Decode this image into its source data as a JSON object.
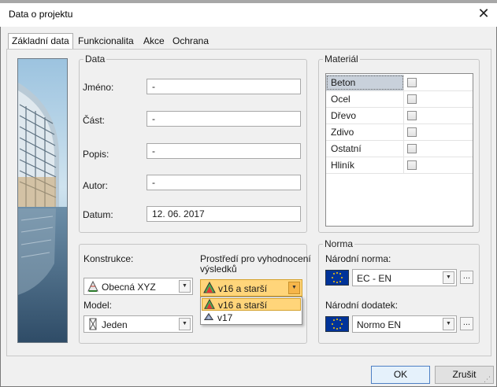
{
  "window": {
    "title": "Data o projektu",
    "close_glyph": "✕"
  },
  "tabs": [
    {
      "label": "Základní data",
      "active": true
    },
    {
      "label": "Funkcionalita",
      "active": false
    },
    {
      "label": "Akce",
      "active": false
    },
    {
      "label": "Ochrana",
      "active": false
    }
  ],
  "data_group": {
    "legend": "Data",
    "fields": [
      {
        "label": "Jméno:",
        "value": "-"
      },
      {
        "label": "Část:",
        "value": "-"
      },
      {
        "label": "Popis:",
        "value": "-"
      },
      {
        "label": "Autor:",
        "value": "-"
      },
      {
        "label": "Datum:",
        "value": "12. 06. 2017"
      }
    ]
  },
  "material_group": {
    "legend": "Materiál",
    "items": [
      {
        "name": "Beton",
        "checked": false,
        "selected": true
      },
      {
        "name": "Ocel",
        "checked": false,
        "selected": false
      },
      {
        "name": "Dřevo",
        "checked": false,
        "selected": false
      },
      {
        "name": "Zdivo",
        "checked": false,
        "selected": false
      },
      {
        "name": "Ostatní",
        "checked": false,
        "selected": false
      },
      {
        "name": "Hliník",
        "checked": false,
        "selected": false
      }
    ]
  },
  "construction": {
    "konstrukce_label": "Konstrukce:",
    "konstrukce_value": "Obecná XYZ",
    "model_label": "Model:",
    "model_value": "Jeden",
    "prostredi_label_line1": "Prostředí pro vyhodnocení",
    "prostredi_label_line2": "výsledků",
    "prostredi_value": "v16 a starší",
    "prostredi_options": [
      "v16 a starší",
      "v17"
    ],
    "prostredi_selected_index": 0
  },
  "norma_group": {
    "legend": "Norma",
    "narodni_norma_label": "Národní norma:",
    "narodni_norma_value": "EC - EN",
    "narodni_dodatek_label": "Národní dodatek:",
    "narodni_dodatek_value": "Normo EN"
  },
  "buttons": {
    "ok": "OK",
    "cancel": "Zrušit",
    "browse": "..."
  },
  "icons": {
    "photo": "building-photo",
    "structure": "structure-icon",
    "model": "model-icon",
    "version": "version-icon",
    "flag": "eu-flag-icon",
    "arrow": "chevron-down-icon"
  },
  "colors": {
    "highlight": "#ffd57a",
    "selection": "#c9d1db",
    "flag_blue": "#003399",
    "flag_star": "#ffcc00"
  }
}
